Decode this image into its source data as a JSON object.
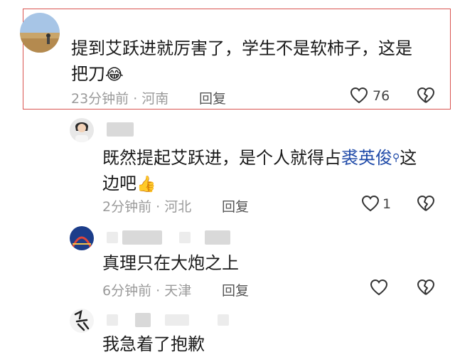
{
  "comments": [
    {
      "text_line1": "提到艾跃进就厉害了，学生不是软柿子，这是",
      "text_line2": "把刀",
      "emoji": "😂",
      "time": "23分钟前 · 河南",
      "reply_label": "回复",
      "like_count": "76"
    },
    {
      "text_prefix": "既然提起艾跃进，是个人就得占",
      "mention": "裘英俊",
      "text_suffix": "这",
      "text_line2": "边吧",
      "emoji": "👍",
      "time": "2分钟前 · 河北",
      "reply_label": "回复",
      "like_count": "1"
    },
    {
      "text": "真理只在大炮之上",
      "time": "6分钟前 · 天津",
      "reply_label": "回复"
    },
    {
      "text": "我急着了抱歉"
    }
  ],
  "colors": {
    "highlight_border": "#d9534f",
    "mention_blue": "#1f4aa8",
    "meta_gray": "#9a9a9a"
  }
}
